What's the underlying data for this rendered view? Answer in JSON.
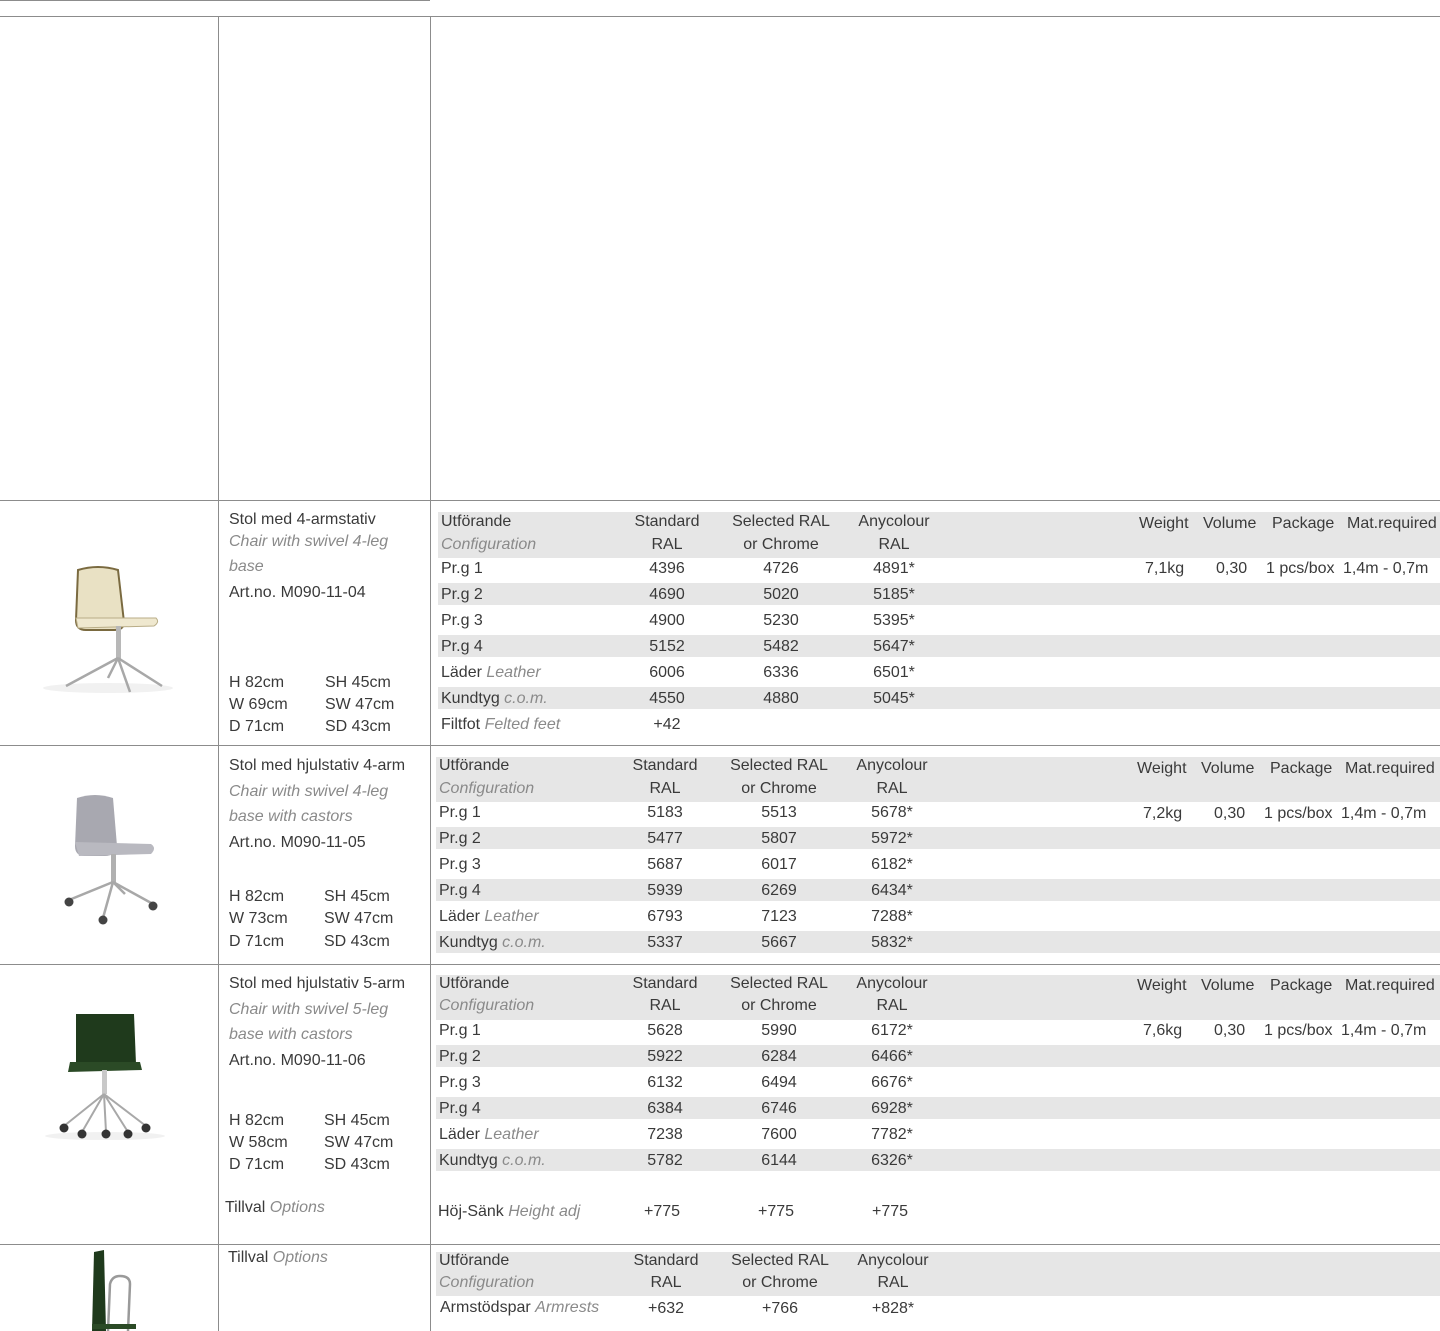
{
  "headers": {
    "config": "Utförande",
    "config_en": "Configuration",
    "standard_1": "Standard",
    "standard_2": "RAL",
    "selected_1": "Selected RAL",
    "selected_2": "or Chrome",
    "anycolour_1": "Anycolour",
    "anycolour_2": "RAL",
    "weight": "Weight",
    "volume": "Volume",
    "package": "Package",
    "mat": "Mat.required"
  },
  "products": [
    {
      "title": "Stol med 4-armstativ",
      "title_en_1": "Chair with swivel 4-leg",
      "title_en_2": "base",
      "art": "Art.no. M090-11-04",
      "dims": [
        "H 82cm",
        "SH 45cm",
        "W 69cm",
        "SW 47cm",
        "D 71cm",
        "SD 43cm"
      ],
      "weight": "7,1kg",
      "volume": "0,30",
      "package": "1 pcs/box",
      "mat": "1,4m - 0,7m",
      "rows": [
        {
          "a": "Pr.g 1",
          "b": "",
          "s": "4396",
          "r": "4726",
          "c": "4891*"
        },
        {
          "a": "Pr.g 2",
          "b": "",
          "s": "4690",
          "r": "5020",
          "c": "5185*"
        },
        {
          "a": "Pr.g 3",
          "b": "",
          "s": "4900",
          "r": "5230",
          "c": "5395*"
        },
        {
          "a": "Pr.g 4",
          "b": "",
          "s": "5152",
          "r": "5482",
          "c": "5647*"
        },
        {
          "a": "Läder ",
          "b": "Leather",
          "s": "6006",
          "r": "6336",
          "c": "6501*"
        },
        {
          "a": "Kundtyg ",
          "b": "c.o.m.",
          "s": "4550",
          "r": "4880",
          "c": "5045*"
        },
        {
          "a": "Filtfot ",
          "b": "Felted feet",
          "s": "+42",
          "r": "",
          "c": ""
        }
      ]
    },
    {
      "title": "Stol med hjulstativ 4-arm",
      "title_en_1": "Chair with swivel 4-leg",
      "title_en_2": "base with castors",
      "art": "Art.no. M090-11-05",
      "dims": [
        "H 82cm",
        "SH 45cm",
        "W 73cm",
        "SW 47cm",
        "D 71cm",
        "SD 43cm"
      ],
      "weight": "7,2kg",
      "volume": "0,30",
      "package": "1 pcs/box",
      "mat": "1,4m - 0,7m",
      "rows": [
        {
          "a": "Pr.g 1",
          "b": "",
          "s": "5183",
          "r": "5513",
          "c": "5678*"
        },
        {
          "a": "Pr.g 2",
          "b": "",
          "s": "5477",
          "r": "5807",
          "c": "5972*"
        },
        {
          "a": "Pr.g 3",
          "b": "",
          "s": "5687",
          "r": "6017",
          "c": "6182*"
        },
        {
          "a": "Pr.g 4",
          "b": "",
          "s": "5939",
          "r": "6269",
          "c": "6434*"
        },
        {
          "a": "Läder ",
          "b": "Leather",
          "s": "6793",
          "r": "7123",
          "c": "7288*"
        },
        {
          "a": "Kundtyg ",
          "b": "c.o.m.",
          "s": "5337",
          "r": "5667",
          "c": "5832*"
        }
      ]
    },
    {
      "title": "Stol med hjulstativ 5-arm",
      "title_en_1": "Chair with swivel 5-leg",
      "title_en_2": "base with castors",
      "art": "Art.no. M090-11-06",
      "dims": [
        "H 82cm",
        "SH 45cm",
        "W 58cm",
        "SW 47cm",
        "D 71cm",
        "SD 43cm"
      ],
      "weight": "7,6kg",
      "volume": "0,30",
      "package": "1 pcs/box",
      "mat": "1,4m - 0,7m",
      "rows": [
        {
          "a": "Pr.g 1",
          "b": "",
          "s": "5628",
          "r": "5990",
          "c": "6172*"
        },
        {
          "a": "Pr.g 2",
          "b": "",
          "s": "5922",
          "r": "6284",
          "c": "6466*"
        },
        {
          "a": "Pr.g 3",
          "b": "",
          "s": "6132",
          "r": "6494",
          "c": "6676*"
        },
        {
          "a": "Pr.g 4",
          "b": "",
          "s": "6384",
          "r": "6746",
          "c": "6928*"
        },
        {
          "a": "Läder ",
          "b": "Leather",
          "s": "7238",
          "r": "7600",
          "c": "7782*"
        },
        {
          "a": "Kundtyg ",
          "b": "c.o.m.",
          "s": "5782",
          "r": "6144",
          "c": "6326*"
        }
      ],
      "option_label": "Tillval ",
      "option_label_en": "Options",
      "option_row": {
        "a": "Höj-Sänk ",
        "b": "Height adj",
        "s": "+775",
        "r": "+775",
        "c": "+775"
      }
    }
  ],
  "options_section": {
    "label": "Tillval ",
    "label_en": "Options",
    "row": {
      "a": "Armstödspar ",
      "b": "Armrests",
      "s": "+632",
      "r": "+766",
      "c": "+828*"
    }
  }
}
